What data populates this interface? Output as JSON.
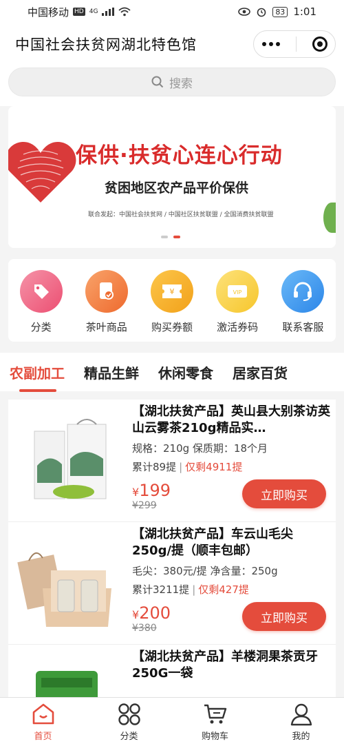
{
  "status": {
    "carrier": "中国移动",
    "hd": "HD",
    "net": "4G",
    "battery": "83",
    "time": "1:01"
  },
  "header": {
    "title": "中国社会扶贫网湖北特色馆"
  },
  "search": {
    "placeholder": "搜索"
  },
  "banner": {
    "title": "保供·扶贫心连心行动",
    "subtitle": "贫困地区农产品平价保供",
    "small": "联合发起：中国社会扶贫网 / 中国社区扶贫联盟 / 全国消费扶贫联盟"
  },
  "quick_icons": [
    {
      "label": "分类",
      "icon": "tag-icon",
      "color": "#f06a8a"
    },
    {
      "label": "茶叶商品",
      "icon": "document-check-icon",
      "color": "#f38a4a"
    },
    {
      "label": "购买券额",
      "icon": "coupon-icon",
      "color": "#f5b52a"
    },
    {
      "label": "激活券码",
      "icon": "vip-card-icon",
      "color": "#f8d44a"
    },
    {
      "label": "联系客服",
      "icon": "headset-icon",
      "color": "#3b9cf0"
    }
  ],
  "tabs": [
    "农副加工",
    "精品生鲜",
    "休闲零食",
    "居家百货"
  ],
  "products": [
    {
      "title": "【湖北扶贫产品】英山县大别茶访英山云雾茶210g精品实…",
      "spec": "规格：210g 保质期：18个月",
      "sold": "累计89提",
      "left": "仅剩4911提",
      "currency": "¥",
      "price": "199",
      "orig": "¥299",
      "buy": "立即购买"
    },
    {
      "title": "【湖北扶贫产品】车云山毛尖250g/提（顺丰包邮）",
      "spec": "毛尖：380元/提 净含量：250g",
      "sold": "累计3211提",
      "left": "仅剩427提",
      "currency": "¥",
      "price": "200",
      "orig": "¥380",
      "buy": "立即购买"
    },
    {
      "title": "【湖北扶贫产品】羊楼洞果茶贡牙250G一袋"
    }
  ],
  "tabbar": [
    {
      "label": "首页",
      "icon": "home-icon"
    },
    {
      "label": "分类",
      "icon": "grid-icon"
    },
    {
      "label": "购物车",
      "icon": "cart-icon"
    },
    {
      "label": "我的",
      "icon": "user-icon"
    }
  ],
  "colors": {
    "accent": "#e44c3c"
  }
}
